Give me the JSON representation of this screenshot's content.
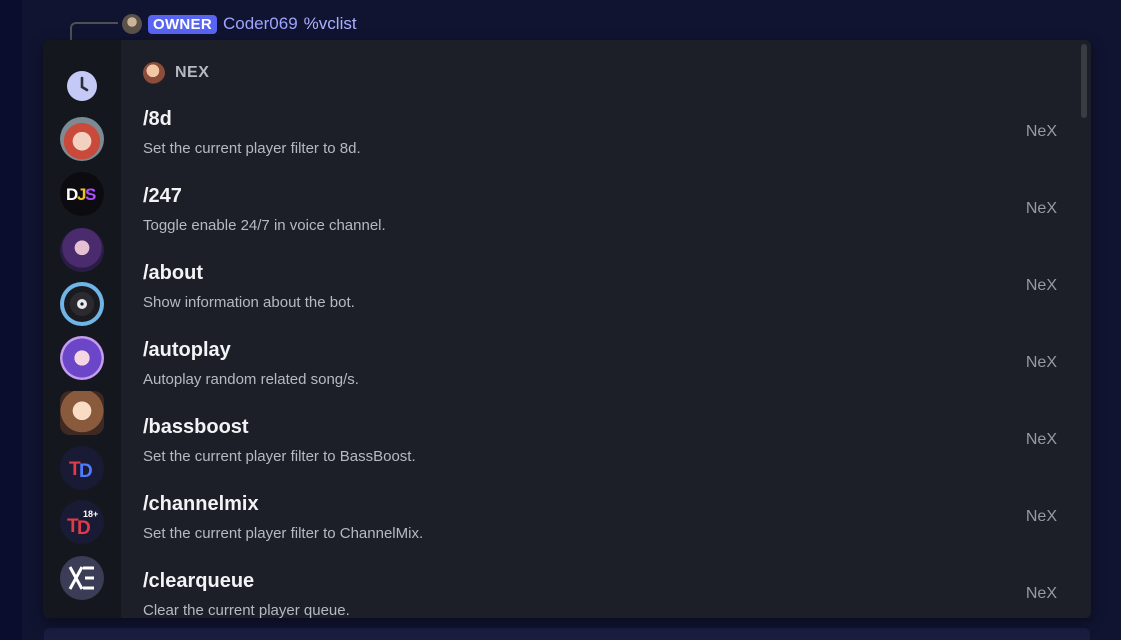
{
  "reply": {
    "badge": "OWNER",
    "username": "Coder069",
    "command": "%vclist"
  },
  "rail": {
    "icons": [
      {
        "name": "recent-clock-icon"
      },
      {
        "name": "bot-avatar-redhair"
      },
      {
        "name": "djs-logo"
      },
      {
        "name": "bot-avatar-anime-girl-dark"
      },
      {
        "name": "bot-avatar-vinyl-disc"
      },
      {
        "name": "bot-avatar-anime-girl-headphones"
      },
      {
        "name": "bot-avatar-anime-girl-brown"
      },
      {
        "name": "td-logo"
      },
      {
        "name": "td-18-logo"
      },
      {
        "name": "xe-logo"
      }
    ]
  },
  "section": {
    "name": "NEX"
  },
  "commands": [
    {
      "name": "/8d",
      "desc": "Set the current player filter to 8d.",
      "source": "NeX"
    },
    {
      "name": "/247",
      "desc": "Toggle enable 24/7 in voice channel.",
      "source": "NeX"
    },
    {
      "name": "/about",
      "desc": "Show information about the bot.",
      "source": "NeX"
    },
    {
      "name": "/autoplay",
      "desc": "Autoplay random related song/s.",
      "source": "NeX"
    },
    {
      "name": "/bassboost",
      "desc": "Set the current player filter to BassBoost.",
      "source": "NeX"
    },
    {
      "name": "/channelmix",
      "desc": "Set the current player filter to ChannelMix.",
      "source": "NeX"
    },
    {
      "name": "/clearqueue",
      "desc": "Clear the current player queue.",
      "source": "NeX"
    }
  ],
  "colors": {
    "accent": "#5865f2",
    "popup_bg": "#1d1f28",
    "rail_bg": "#15171e"
  }
}
